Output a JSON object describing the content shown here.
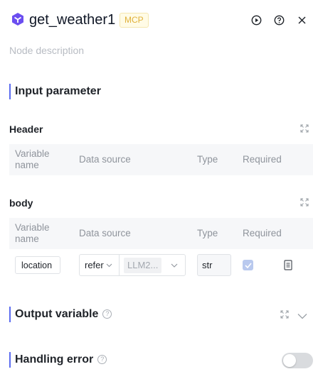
{
  "node": {
    "title": "get_weather1",
    "badge": "MCP",
    "description_placeholder": "Node description",
    "accent_color": "#5b6cf0",
    "icon": "cube-icon"
  },
  "header_actions": [
    "run-icon",
    "help-icon",
    "close-icon"
  ],
  "input_section": {
    "title": "Input parameter",
    "groups": [
      {
        "label": "Header",
        "columns": [
          "Variable name",
          "Data source",
          "Type",
          "Required"
        ],
        "rows": []
      },
      {
        "label": "body",
        "columns": [
          "Variable name",
          "Data source",
          "Type",
          "Required"
        ],
        "rows": [
          {
            "name": "location",
            "source_mode": "refer",
            "source_value": "LLM2...",
            "type": "str",
            "required": true
          }
        ]
      }
    ]
  },
  "output_section": {
    "title": "Output variable"
  },
  "error_section": {
    "title": "Handling error",
    "enabled": false
  }
}
